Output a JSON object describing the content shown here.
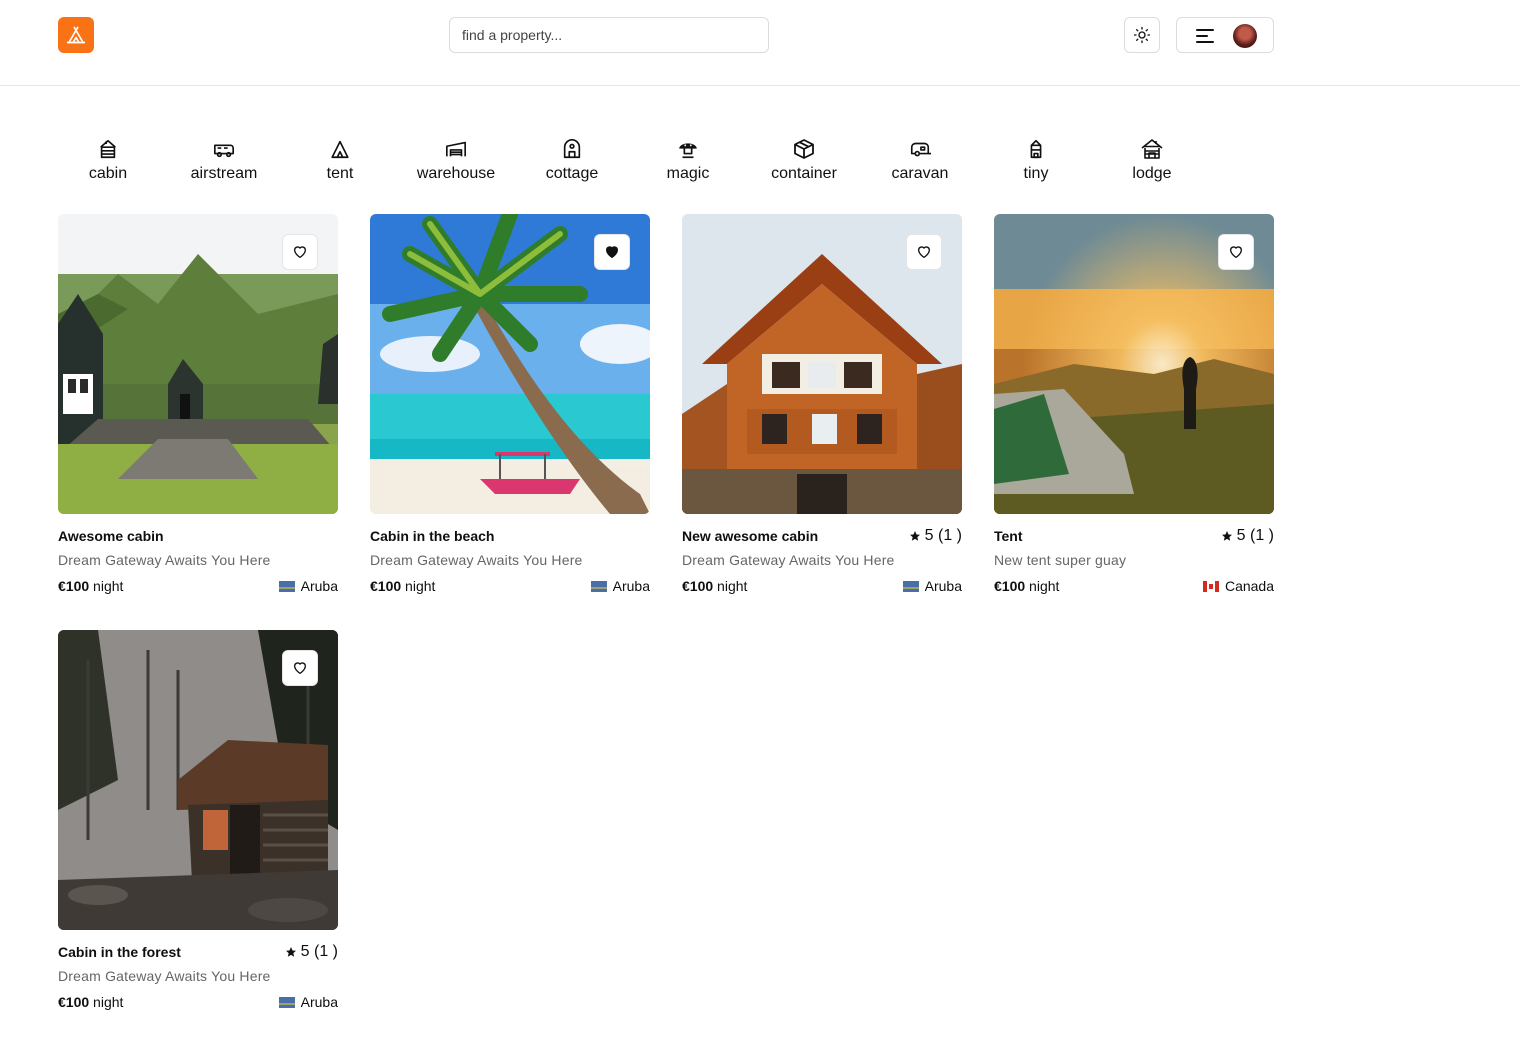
{
  "header": {
    "logo_icon": "tent-icon",
    "search_placeholder": "find a property...",
    "theme_icon": "sun-icon",
    "menu_icon": "menu-icon"
  },
  "categories": [
    {
      "label": "cabin",
      "icon": "cabin-icon"
    },
    {
      "label": "airstream",
      "icon": "airstream-icon"
    },
    {
      "label": "tent",
      "icon": "tent-icon"
    },
    {
      "label": "warehouse",
      "icon": "warehouse-icon"
    },
    {
      "label": "cottage",
      "icon": "cottage-icon"
    },
    {
      "label": "magic",
      "icon": "magic-icon"
    },
    {
      "label": "container",
      "icon": "container-icon"
    },
    {
      "label": "caravan",
      "icon": "caravan-icon"
    },
    {
      "label": "tiny",
      "icon": "tiny-icon"
    },
    {
      "label": "lodge",
      "icon": "lodge-icon"
    }
  ],
  "properties": [
    {
      "title": "Awesome cabin",
      "subtitle": "Dream Gateway Awaits You Here",
      "price": "€100",
      "unit": "night",
      "country": "Aruba",
      "rating": "",
      "favorite": false
    },
    {
      "title": "Cabin in the beach",
      "subtitle": "Dream Gateway Awaits You Here",
      "price": "€100",
      "unit": "night",
      "country": "Aruba",
      "rating": "",
      "favorite": true
    },
    {
      "title": "New awesome cabin",
      "subtitle": "Dream Gateway Awaits You Here",
      "price": "€100",
      "unit": "night",
      "country": "Aruba",
      "rating": "5 (1 )",
      "favorite": false
    },
    {
      "title": "Tent",
      "subtitle": "New tent super guay",
      "price": "€100",
      "unit": "night",
      "country": "Canada",
      "rating": "5 (1 )",
      "favorite": false
    },
    {
      "title": "Cabin in the forest",
      "subtitle": "Dream Gateway Awaits You Here",
      "price": "€100",
      "unit": "night",
      "country": "Aruba",
      "rating": "5 (1 )",
      "favorite": false
    }
  ],
  "colors": {
    "brand": "#f97316"
  }
}
